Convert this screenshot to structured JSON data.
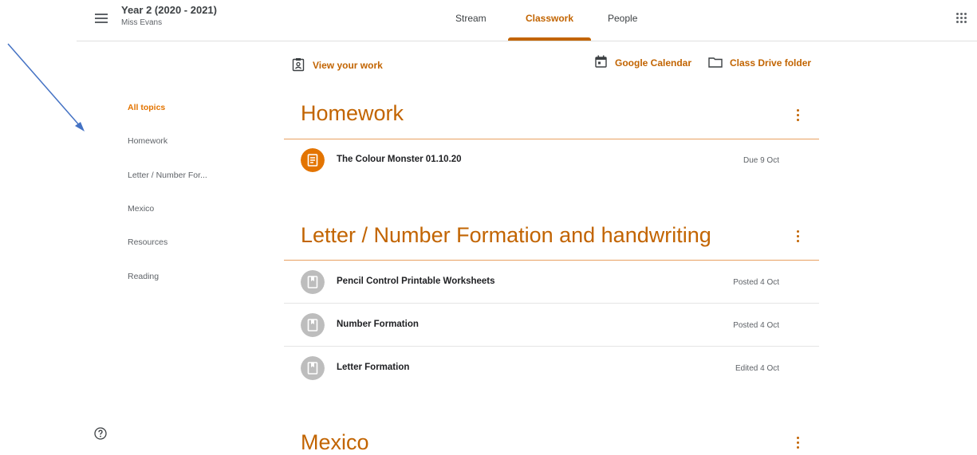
{
  "header": {
    "class_name": "Year 2 (2020 - 2021)",
    "teacher": "Miss Evans",
    "tabs": [
      {
        "label": "Stream"
      },
      {
        "label": "Classwork"
      },
      {
        "label": "People"
      }
    ],
    "active_tab": "Classwork"
  },
  "actions": {
    "view_work": "View your work",
    "calendar": "Google Calendar",
    "drive": "Class Drive folder"
  },
  "topics": [
    {
      "label": "All topics",
      "active": true
    },
    {
      "label": "Homework"
    },
    {
      "label": "Letter / Number For..."
    },
    {
      "label": "Mexico"
    },
    {
      "label": "Resources"
    },
    {
      "label": "Reading"
    }
  ],
  "sections": [
    {
      "title": "Homework",
      "items": [
        {
          "title": "The Colour Monster 01.10.20",
          "meta": "Due 9 Oct",
          "type": "assignment-icon"
        }
      ]
    },
    {
      "title": "Letter / Number Formation and handwriting",
      "items": [
        {
          "title": "Pencil Control Printable Worksheets",
          "meta": "Posted 4 Oct",
          "type": "material-icon"
        },
        {
          "title": "Number Formation",
          "meta": "Posted 4 Oct",
          "type": "material-icon"
        },
        {
          "title": "Letter Formation",
          "meta": "Edited 4 Oct",
          "type": "material-icon"
        }
      ]
    },
    {
      "title": "Mexico",
      "items": []
    }
  ],
  "colors": {
    "accent": "#c26401",
    "assignment": "#e37400",
    "material": "#bdbdbd",
    "arrow": "#4472c4"
  }
}
